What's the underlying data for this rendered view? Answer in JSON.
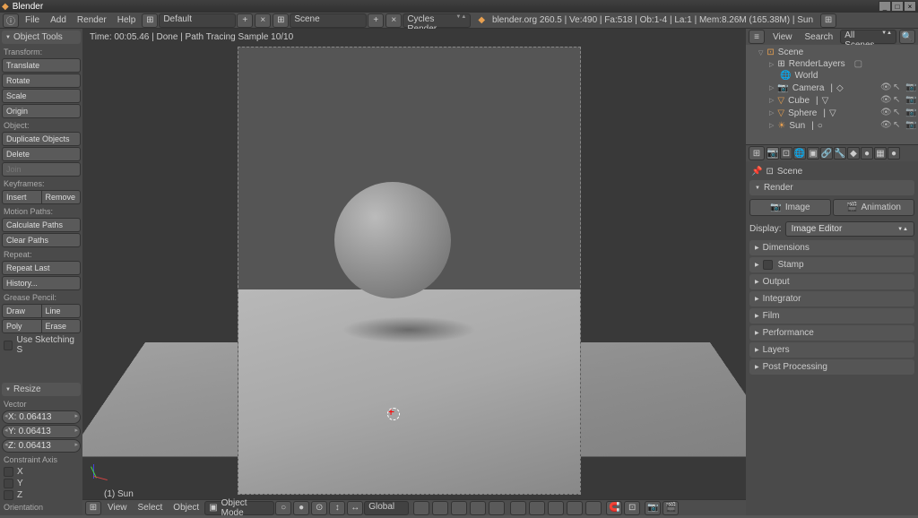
{
  "app": {
    "title": "Blender"
  },
  "titlebar_btns": [
    "_",
    "□",
    "×"
  ],
  "top_menu": {
    "file": "File",
    "add": "Add",
    "render": "Render",
    "help": "Help",
    "layout": "Default",
    "scene": "Scene",
    "engine": "Cycles Render",
    "info": "blender.org 260.5 | Ve:490 | Fa:518 | Ob:1-4 | La:1 | Mem:8.26M (165.38M) | Sun"
  },
  "viewport": {
    "status": "Time: 00:05.46 | Done | Path Tracing Sample 10/10",
    "object_name": "(1) Sun"
  },
  "bottom_bar": {
    "view": "View",
    "select": "Select",
    "object": "Object",
    "mode": "Object Mode",
    "transform": "Global"
  },
  "left_panel": {
    "object_tools": "Object Tools",
    "transform_label": "Transform:",
    "translate": "Translate",
    "rotate": "Rotate",
    "scale": "Scale",
    "origin": "Origin",
    "object_label": "Object:",
    "duplicate": "Duplicate Objects",
    "delete": "Delete",
    "join": "Join",
    "keyframes_label": "Keyframes:",
    "insert": "Insert",
    "remove": "Remove",
    "motion_label": "Motion Paths:",
    "calc": "Calculate Paths",
    "clear": "Clear Paths",
    "repeat_label": "Repeat:",
    "repeat_last": "Repeat Last",
    "history": "History...",
    "grease_label": "Grease Pencil:",
    "draw": "Draw",
    "line": "Line",
    "poly": "Poly",
    "erase": "Erase",
    "sketching": "Use Sketching S",
    "resize": "Resize",
    "vector": "Vector",
    "x": "X: 0.06413",
    "y": "Y: 0.06413",
    "z": "Z: 0.06413",
    "constraint": "Constraint Axis",
    "cx": "X",
    "cy": "Y",
    "cz": "Z",
    "orientation": "Orientation"
  },
  "outliner": {
    "header": {
      "view": "View",
      "search": "Search",
      "filter": "All Scenes"
    },
    "scene": "Scene",
    "items": [
      {
        "label": "RenderLayers"
      },
      {
        "label": "World"
      },
      {
        "label": "Camera"
      },
      {
        "label": "Cube"
      },
      {
        "label": "Sphere"
      },
      {
        "label": "Sun"
      }
    ]
  },
  "props": {
    "breadcrumb": "Scene",
    "render": "Render",
    "image_btn": "Image",
    "anim_btn": "Animation",
    "display": "Display:",
    "display_val": "Image Editor",
    "sections": {
      "dimensions": "Dimensions",
      "stamp": "Stamp",
      "output": "Output",
      "integrator": "Integrator",
      "film": "Film",
      "performance": "Performance",
      "layers": "Layers",
      "post": "Post Processing"
    }
  }
}
